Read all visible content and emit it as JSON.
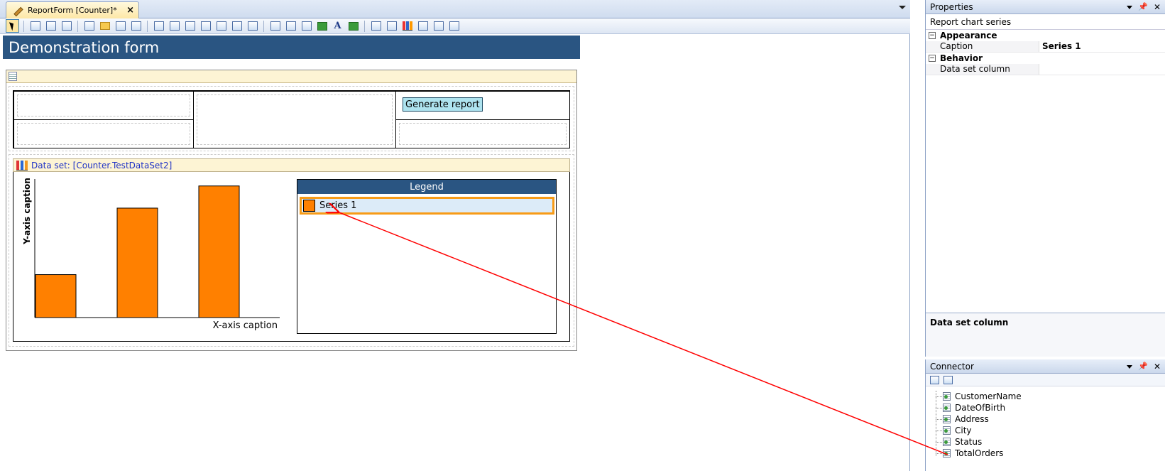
{
  "document_tab": {
    "title": "ReportForm [Counter]*",
    "close": "×"
  },
  "form": {
    "header_title": "Demonstration form",
    "generate_button": "Generate report",
    "chart_dataset_label": "Data set: [Counter.TestDataSet2]"
  },
  "chart_data": {
    "type": "bar",
    "categories": [
      "",
      "",
      ""
    ],
    "series": [
      {
        "name": "Series 1",
        "values": [
          31,
          79,
          95
        ]
      }
    ],
    "xlabel": "X-axis caption",
    "ylabel": "Y-axis caption",
    "ylim": [
      0,
      100
    ],
    "grid": false,
    "legend": "right",
    "legend_title": "Legend",
    "colors": {
      "bar": "#ff8000",
      "legend_header": "#2a5582"
    }
  },
  "properties": {
    "panel_title": "Properties",
    "object_name": "Report chart series",
    "categories": [
      {
        "toggle": "−",
        "name": "Appearance",
        "rows": [
          {
            "name": "Caption",
            "value": "Series 1"
          }
        ]
      },
      {
        "toggle": "−",
        "name": "Behavior",
        "rows": [
          {
            "name": "Data set column",
            "value": ""
          }
        ]
      }
    ],
    "description_title": "Data set column"
  },
  "connector": {
    "panel_title": "Connector",
    "fields": [
      "CustomerName",
      "DateOfBirth",
      "Address",
      "City",
      "Status",
      "TotalOrders"
    ]
  },
  "icons": {
    "pin": "📌",
    "close": "✕"
  },
  "colors": {
    "header_blue": "#2a5582",
    "accent_orange": "#f79b17",
    "annotation_arrow": "#ff0000"
  }
}
